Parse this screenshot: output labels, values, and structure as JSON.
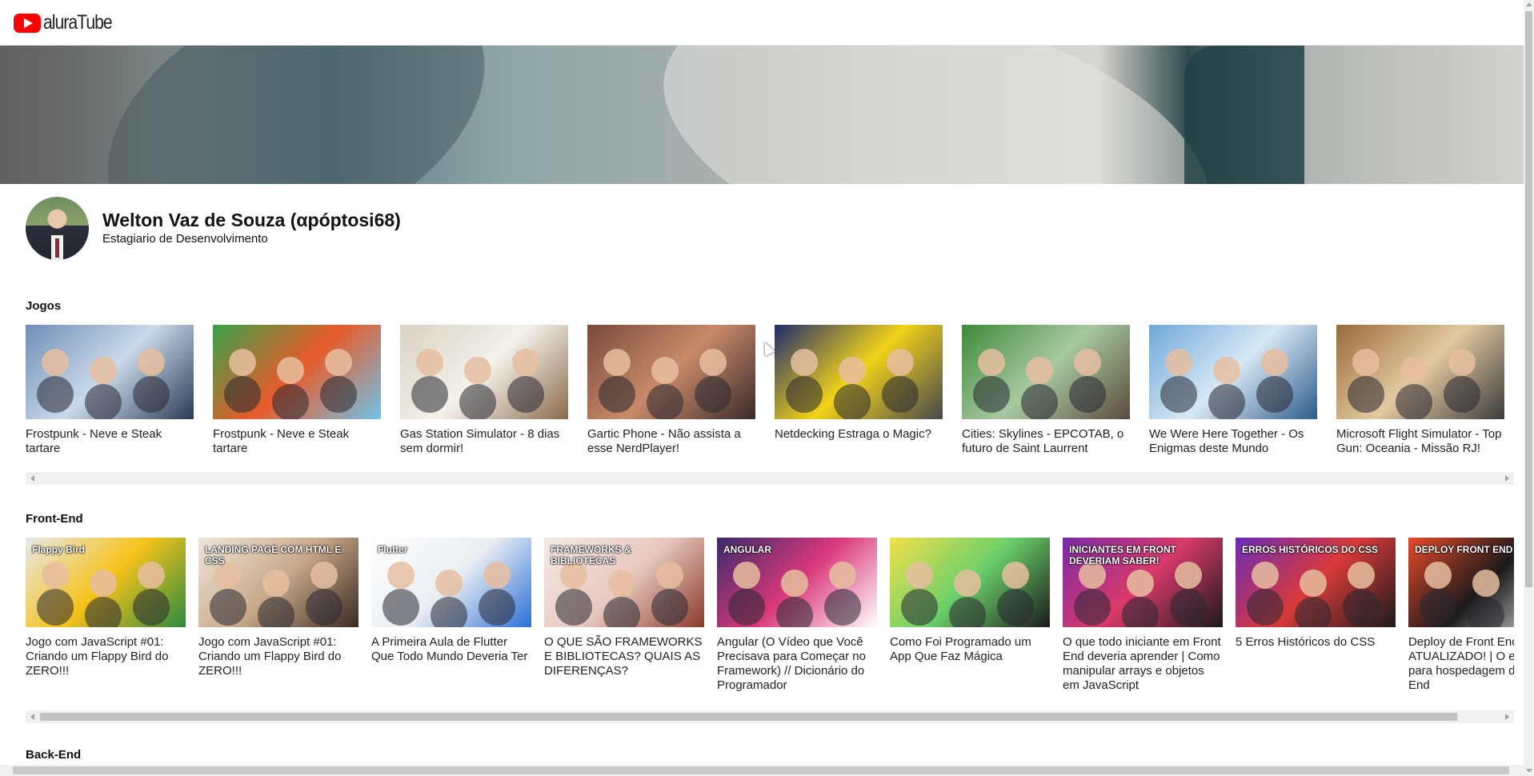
{
  "app": {
    "logo_text": "aluraTube",
    "brand_color": "#ff0000"
  },
  "profile": {
    "name": "Welton Vaz de Souza (αpóptosi68)",
    "role": "Estagiario de Desenvolvimento"
  },
  "sections": [
    {
      "title": "Jogos",
      "videos": [
        {
          "title": "Frostpunk - Neve e Steak tartare",
          "colors": [
            "#6f8fb5",
            "#c9d9ea",
            "#2a3a55"
          ]
        },
        {
          "title": "Frostpunk - Neve e Steak tartare",
          "colors": [
            "#39a24b",
            "#e85b2a",
            "#6fc3e8"
          ]
        },
        {
          "title": "Gas Station Simulator - 8 dias sem dormir!",
          "colors": [
            "#d9d2c4",
            "#f4f1ea",
            "#8a6a4a"
          ]
        },
        {
          "title": "Gartic Phone - Não assista a esse NerdPlayer!",
          "colors": [
            "#7a4a3a",
            "#c98a6a",
            "#3a2a2a"
          ]
        },
        {
          "title": "Netdecking Estraga o Magic?",
          "colors": [
            "#1d2c6b",
            "#f2d21a",
            "#44484f"
          ]
        },
        {
          "title": "Cities: Skylines - EPCOTAB, o futuro de Saint Laurrent",
          "colors": [
            "#3f8a3a",
            "#a7c9a0",
            "#5a4a3a"
          ]
        },
        {
          "title": "We Were Here Together - Os Enigmas deste Mundo",
          "colors": [
            "#6ea8d8",
            "#d7e8f5",
            "#2c5b8a"
          ]
        },
        {
          "title": "Microsoft Flight Simulator - Top Gun: Oceania - Missão RJ!",
          "colors": [
            "#9a6a3a",
            "#e2c9a0",
            "#3a3a3a"
          ]
        }
      ]
    },
    {
      "title": "Front-End",
      "videos": [
        {
          "title": "Jogo com JavaScript #01: Criando um Flappy Bird do ZERO!!!",
          "colors": [
            "#e8e8e8",
            "#f5c21a",
            "#2b8a3e"
          ],
          "label": "Flappy Bird"
        },
        {
          "title": "Jogo com JavaScript #01: Criando um Flappy Bird do ZERO!!!",
          "colors": [
            "#efe6d8",
            "#c9a98a",
            "#3a2a20"
          ],
          "label": "LANDING PAGE COM HTML E CSS"
        },
        {
          "title": "A Primeira Aula de Flutter Que Todo Mundo Deveria Ter",
          "colors": [
            "#ffffff",
            "#e9eef3",
            "#2a6fd6"
          ],
          "label": "Flutter"
        },
        {
          "title": "O QUE SÃO FRAMEWORKS E BIBLIOTECAS? QUAIS AS DIFERENÇAS?",
          "colors": [
            "#f5e9e4",
            "#e8c9c0",
            "#8a3a2a"
          ],
          "label": "FRAMEWORKS & BIBLIOTECAS"
        },
        {
          "title": "Angular (O Vídeo que Você Precisava para Começar no Framework) // Dicionário do Programador",
          "colors": [
            "#3a2a6a",
            "#d9387a",
            "#ffffff"
          ],
          "label": "ANGULAR"
        },
        {
          "title": "Como Foi Programado um App Que Faz Mágica",
          "colors": [
            "#f2e04a",
            "#6ad06a",
            "#1a1a1a"
          ]
        },
        {
          "title": "O que todo iniciante em Front End deveria aprender | Como manipular arrays e objetos em JavaScript",
          "colors": [
            "#7a2aa8",
            "#d93a6a",
            "#1a1a1a"
          ],
          "label": "INICIANTES EM FRONT DEVERIAM SABER!"
        },
        {
          "title": "5 Erros Históricos do CSS",
          "colors": [
            "#6a2ab8",
            "#d93a3a",
            "#1a1a1a"
          ],
          "label": "ERROS HISTÓRICOS DO CSS"
        },
        {
          "title": "Deploy de Front End ATUALIZADO! | O eu uso para hospedagem de Front End",
          "colors": [
            "#e84a2a",
            "#1a1a1a",
            "#f2f2f2"
          ],
          "label": "DEPLOY FRONT END VERCEL"
        }
      ]
    },
    {
      "title": "Back-End",
      "videos": []
    }
  ]
}
